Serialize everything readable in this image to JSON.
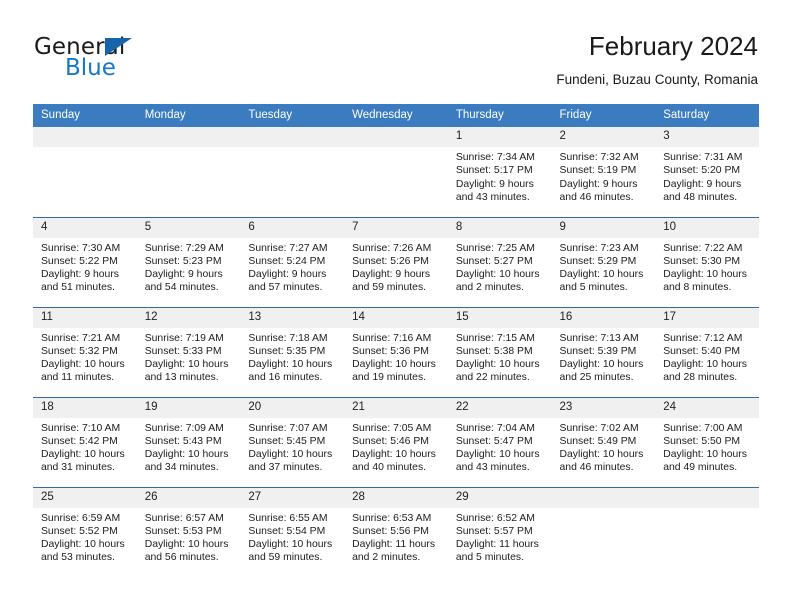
{
  "brand": {
    "word1": "General",
    "word2": "Blue",
    "triangle_color": "#1665ab",
    "blue_color": "#1677c4"
  },
  "header": {
    "title": "February 2024",
    "subtitle": "Fundeni, Buzau County, Romania"
  },
  "theme": {
    "header_bg": "#3a7cbf",
    "row_separator": "#2e6da4",
    "daynum_bg": "#f0f0f0"
  },
  "weekday_headers": [
    "Sunday",
    "Monday",
    "Tuesday",
    "Wednesday",
    "Thursday",
    "Friday",
    "Saturday"
  ],
  "weeks": [
    [
      {
        "day": "",
        "empty": true,
        "line1": "",
        "line2": "",
        "line3": "",
        "line4": ""
      },
      {
        "day": "",
        "empty": true,
        "line1": "",
        "line2": "",
        "line3": "",
        "line4": ""
      },
      {
        "day": "",
        "empty": true,
        "line1": "",
        "line2": "",
        "line3": "",
        "line4": ""
      },
      {
        "day": "",
        "empty": true,
        "line1": "",
        "line2": "",
        "line3": "",
        "line4": ""
      },
      {
        "day": "1",
        "empty": false,
        "line1": "Sunrise: 7:34 AM",
        "line2": "Sunset: 5:17 PM",
        "line3": "Daylight: 9 hours",
        "line4": "and 43 minutes."
      },
      {
        "day": "2",
        "empty": false,
        "line1": "Sunrise: 7:32 AM",
        "line2": "Sunset: 5:19 PM",
        "line3": "Daylight: 9 hours",
        "line4": "and 46 minutes."
      },
      {
        "day": "3",
        "empty": false,
        "line1": "Sunrise: 7:31 AM",
        "line2": "Sunset: 5:20 PM",
        "line3": "Daylight: 9 hours",
        "line4": "and 48 minutes."
      }
    ],
    [
      {
        "day": "4",
        "empty": false,
        "line1": "Sunrise: 7:30 AM",
        "line2": "Sunset: 5:22 PM",
        "line3": "Daylight: 9 hours",
        "line4": "and 51 minutes."
      },
      {
        "day": "5",
        "empty": false,
        "line1": "Sunrise: 7:29 AM",
        "line2": "Sunset: 5:23 PM",
        "line3": "Daylight: 9 hours",
        "line4": "and 54 minutes."
      },
      {
        "day": "6",
        "empty": false,
        "line1": "Sunrise: 7:27 AM",
        "line2": "Sunset: 5:24 PM",
        "line3": "Daylight: 9 hours",
        "line4": "and 57 minutes."
      },
      {
        "day": "7",
        "empty": false,
        "line1": "Sunrise: 7:26 AM",
        "line2": "Sunset: 5:26 PM",
        "line3": "Daylight: 9 hours",
        "line4": "and 59 minutes."
      },
      {
        "day": "8",
        "empty": false,
        "line1": "Sunrise: 7:25 AM",
        "line2": "Sunset: 5:27 PM",
        "line3": "Daylight: 10 hours",
        "line4": "and 2 minutes."
      },
      {
        "day": "9",
        "empty": false,
        "line1": "Sunrise: 7:23 AM",
        "line2": "Sunset: 5:29 PM",
        "line3": "Daylight: 10 hours",
        "line4": "and 5 minutes."
      },
      {
        "day": "10",
        "empty": false,
        "line1": "Sunrise: 7:22 AM",
        "line2": "Sunset: 5:30 PM",
        "line3": "Daylight: 10 hours",
        "line4": "and 8 minutes."
      }
    ],
    [
      {
        "day": "11",
        "empty": false,
        "line1": "Sunrise: 7:21 AM",
        "line2": "Sunset: 5:32 PM",
        "line3": "Daylight: 10 hours",
        "line4": "and 11 minutes."
      },
      {
        "day": "12",
        "empty": false,
        "line1": "Sunrise: 7:19 AM",
        "line2": "Sunset: 5:33 PM",
        "line3": "Daylight: 10 hours",
        "line4": "and 13 minutes."
      },
      {
        "day": "13",
        "empty": false,
        "line1": "Sunrise: 7:18 AM",
        "line2": "Sunset: 5:35 PM",
        "line3": "Daylight: 10 hours",
        "line4": "and 16 minutes."
      },
      {
        "day": "14",
        "empty": false,
        "line1": "Sunrise: 7:16 AM",
        "line2": "Sunset: 5:36 PM",
        "line3": "Daylight: 10 hours",
        "line4": "and 19 minutes."
      },
      {
        "day": "15",
        "empty": false,
        "line1": "Sunrise: 7:15 AM",
        "line2": "Sunset: 5:38 PM",
        "line3": "Daylight: 10 hours",
        "line4": "and 22 minutes."
      },
      {
        "day": "16",
        "empty": false,
        "line1": "Sunrise: 7:13 AM",
        "line2": "Sunset: 5:39 PM",
        "line3": "Daylight: 10 hours",
        "line4": "and 25 minutes."
      },
      {
        "day": "17",
        "empty": false,
        "line1": "Sunrise: 7:12 AM",
        "line2": "Sunset: 5:40 PM",
        "line3": "Daylight: 10 hours",
        "line4": "and 28 minutes."
      }
    ],
    [
      {
        "day": "18",
        "empty": false,
        "line1": "Sunrise: 7:10 AM",
        "line2": "Sunset: 5:42 PM",
        "line3": "Daylight: 10 hours",
        "line4": "and 31 minutes."
      },
      {
        "day": "19",
        "empty": false,
        "line1": "Sunrise: 7:09 AM",
        "line2": "Sunset: 5:43 PM",
        "line3": "Daylight: 10 hours",
        "line4": "and 34 minutes."
      },
      {
        "day": "20",
        "empty": false,
        "line1": "Sunrise: 7:07 AM",
        "line2": "Sunset: 5:45 PM",
        "line3": "Daylight: 10 hours",
        "line4": "and 37 minutes."
      },
      {
        "day": "21",
        "empty": false,
        "line1": "Sunrise: 7:05 AM",
        "line2": "Sunset: 5:46 PM",
        "line3": "Daylight: 10 hours",
        "line4": "and 40 minutes."
      },
      {
        "day": "22",
        "empty": false,
        "line1": "Sunrise: 7:04 AM",
        "line2": "Sunset: 5:47 PM",
        "line3": "Daylight: 10 hours",
        "line4": "and 43 minutes."
      },
      {
        "day": "23",
        "empty": false,
        "line1": "Sunrise: 7:02 AM",
        "line2": "Sunset: 5:49 PM",
        "line3": "Daylight: 10 hours",
        "line4": "and 46 minutes."
      },
      {
        "day": "24",
        "empty": false,
        "line1": "Sunrise: 7:00 AM",
        "line2": "Sunset: 5:50 PM",
        "line3": "Daylight: 10 hours",
        "line4": "and 49 minutes."
      }
    ],
    [
      {
        "day": "25",
        "empty": false,
        "line1": "Sunrise: 6:59 AM",
        "line2": "Sunset: 5:52 PM",
        "line3": "Daylight: 10 hours",
        "line4": "and 53 minutes."
      },
      {
        "day": "26",
        "empty": false,
        "line1": "Sunrise: 6:57 AM",
        "line2": "Sunset: 5:53 PM",
        "line3": "Daylight: 10 hours",
        "line4": "and 56 minutes."
      },
      {
        "day": "27",
        "empty": false,
        "line1": "Sunrise: 6:55 AM",
        "line2": "Sunset: 5:54 PM",
        "line3": "Daylight: 10 hours",
        "line4": "and 59 minutes."
      },
      {
        "day": "28",
        "empty": false,
        "line1": "Sunrise: 6:53 AM",
        "line2": "Sunset: 5:56 PM",
        "line3": "Daylight: 11 hours",
        "line4": "and 2 minutes."
      },
      {
        "day": "29",
        "empty": false,
        "line1": "Sunrise: 6:52 AM",
        "line2": "Sunset: 5:57 PM",
        "line3": "Daylight: 11 hours",
        "line4": "and 5 minutes."
      },
      {
        "day": "",
        "empty": true,
        "line1": "",
        "line2": "",
        "line3": "",
        "line4": ""
      },
      {
        "day": "",
        "empty": true,
        "line1": "",
        "line2": "",
        "line3": "",
        "line4": ""
      }
    ]
  ]
}
